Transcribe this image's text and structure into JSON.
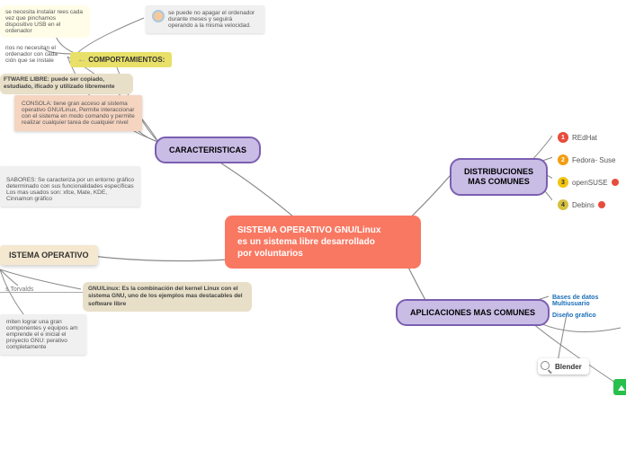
{
  "center": {
    "line1": "SISTEMA OPERATIVO GNU/Linux",
    "line2": "es un sistema libre desarrollado",
    "line3": "por voluntarios"
  },
  "comportamientos": {
    "label": "COMPORTAMIENTOS:",
    "bubble1": "se puede no apagar el ordenador durante meses y seguirá operando a la misma velocidad.",
    "bubble2": "se necesita instalar rees  cada vez que pinchamos dispositivo USB en el ordenador",
    "bubble3": "rios no necesitan el ordenador con cada ción que se instale"
  },
  "softlibre": "FTWARE LIBRE:  puede ser copiado, estudiado, ificado y utilizado libremente",
  "caracteristicas": {
    "label": "CARACTERISTICAS",
    "consola": "CONSOLA:  tiene gran acceso al sistema operativo GNU/Linux, Permite interaccionar con el sistema en modo comando y permite realizar cualquier tarea de cualquier nivel",
    "sabores": "SABORES:   Se caracteriza por un entorno gráfico determinado con sus funcionalidades específicas\nLos mas usados son:  xfce, Mate, KDE, Cinnamon gráfico"
  },
  "so": {
    "label": "ISTEMA OPERATIVO",
    "torvalds": "s Torvalds",
    "gnulinux": "GNU/Linux:  Es la combinación del kernel Linux con el sistema  GNU, uno de los ejemplos mas destacables del software libre",
    "extra": "miten lograr una gran componentes y equipos am emprende el e inicial el proyecto GNU: perativo completamente"
  },
  "distribuciones": {
    "label1": "DISTRIBUCIONES",
    "label2": "MAS COMUNES",
    "items": [
      {
        "num": "1",
        "label": "REdHat"
      },
      {
        "num": "2",
        "label": "Fedora- Suse"
      },
      {
        "num": "3",
        "label": "openSUSE"
      },
      {
        "num": "4",
        "label": "Debins"
      }
    ]
  },
  "aplicaciones": {
    "label": "APLICACIONES MAS COMUNES",
    "items": [
      "Bases de datos Multiusuario",
      "Diseño grafico"
    ],
    "blender": "Blender"
  }
}
